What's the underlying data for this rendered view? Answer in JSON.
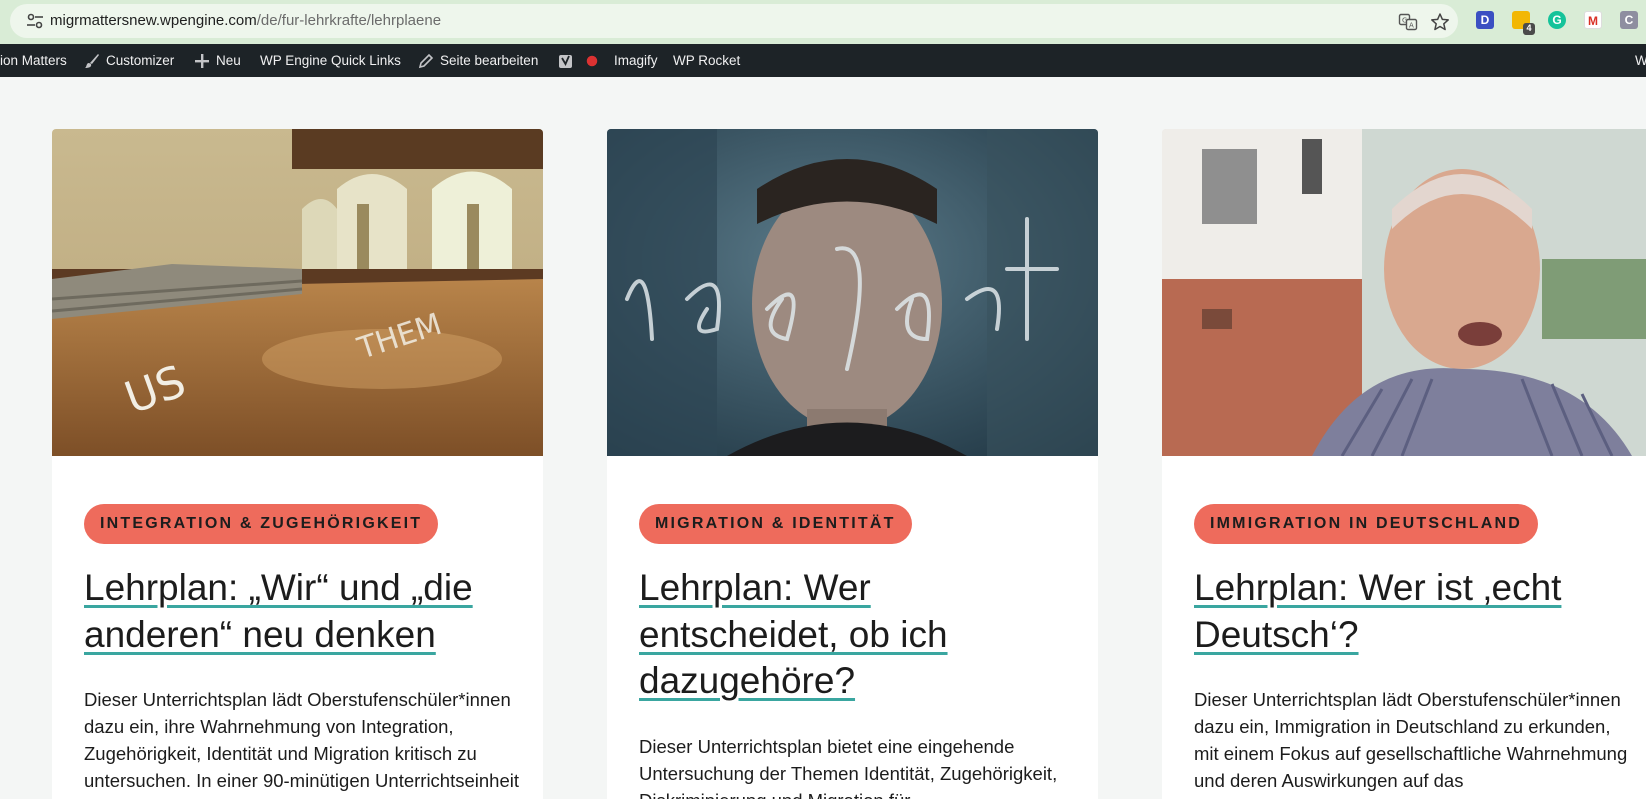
{
  "browser": {
    "url_domain": "migrmattersnew.wpengine.com",
    "url_path": "/de/fur-lehrkrafte/lehrplaene",
    "extensions": [
      {
        "name": "d-extension-icon",
        "label": "D",
        "color": "#3b4fc2"
      },
      {
        "name": "folder-extension-icon",
        "badge": "4",
        "color": "#f2b705"
      },
      {
        "name": "grammarly-icon",
        "color": "#15c39a"
      },
      {
        "name": "gmail-icon",
        "color": "#d93025"
      },
      {
        "name": "c-extension-icon",
        "label": "C",
        "color": "#8e8ea0"
      }
    ]
  },
  "adminbar": {
    "site_name": "ion Matters",
    "customizer": "Customizer",
    "new": "Neu",
    "quick_links": "WP Engine Quick Links",
    "edit_page": "Seite bearbeiten",
    "imagify": "Imagify",
    "rocket": "WP Rocket",
    "right_cut": "W"
  },
  "colors": {
    "badge_bg": "#ee6b5c",
    "title_underline": "#3aa6a0",
    "adminbar_bg": "#1d2327"
  },
  "cards": [
    {
      "category": "INTEGRATION & ZUGEHÖRIGKEIT",
      "title_line1": "Lehrplan: „Wir“ und „die",
      "title_line2": "anderen“ neu denken",
      "title_line3": "",
      "desc_line1": "Dieser Unterrichtsplan lädt Oberstufenschüler*innen",
      "desc_line2": "dazu ein, ihre Wahrnehmung von Integration,",
      "desc_line3": "Zugehörigkeit, Identität und Migration kritisch zu",
      "desc_line4": "untersuchen. In einer 90-minütigen Unterrichtseinheit"
    },
    {
      "category": "MIGRATION & IDENTITÄT",
      "title_line1": "Lehrplan: Wer",
      "title_line2": "entscheidet, ob ich",
      "title_line3": "dazugehöre?",
      "desc_line1": "Dieser Unterrichtsplan bietet eine eingehende",
      "desc_line2": "Untersuchung der Themen Identität, Zugehörigkeit,",
      "desc_line3": "Diskriminierung und Migration für",
      "desc_line4": ""
    },
    {
      "category": "IMMIGRATION IN DEUTSCHLAND",
      "title_line1": "Lehrplan: Wer ist ‚echt",
      "title_line2": "Deutsch‘?",
      "title_line3": "",
      "desc_line1": "Dieser Unterrichtsplan lädt Oberstufenschüler*innen",
      "desc_line2": "dazu ein, Immigration in Deutschland zu erkunden,",
      "desc_line3": "mit einem Fokus auf gesellschaftliche Wahrnehmung",
      "desc_line4": "und deren Auswirkungen auf das"
    }
  ]
}
